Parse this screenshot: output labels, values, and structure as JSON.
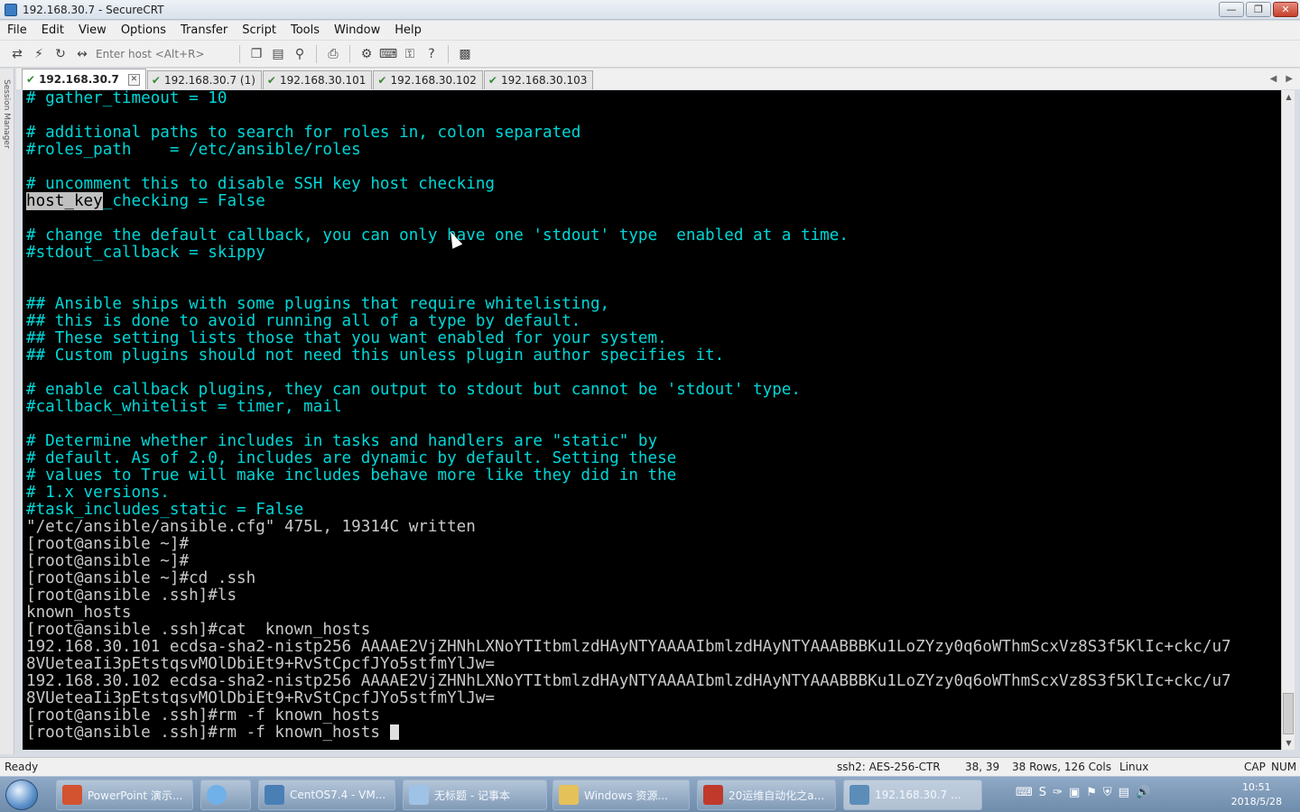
{
  "window": {
    "title": "192.168.30.7 - SecureCRT"
  },
  "menu": [
    "File",
    "Edit",
    "View",
    "Options",
    "Transfer",
    "Script",
    "Tools",
    "Window",
    "Help"
  ],
  "toolbar": {
    "enter_host_placeholder": "Enter host <Alt+R>"
  },
  "session_manager_label": "Session Manager",
  "tabs": [
    {
      "label": "192.168.30.7",
      "active": true
    },
    {
      "label": "192.168.30.7 (1)",
      "active": false
    },
    {
      "label": "192.168.30.101",
      "active": false
    },
    {
      "label": "192.168.30.102",
      "active": false
    },
    {
      "label": "192.168.30.103",
      "active": false
    }
  ],
  "terminal": {
    "lines": [
      {
        "text": "# gather_timeout = 10",
        "style": "comment"
      },
      {
        "text": "",
        "style": "comment"
      },
      {
        "text": "# additional paths to search for roles in, colon separated",
        "style": "comment"
      },
      {
        "text": "#roles_path    = /etc/ansible/roles",
        "style": "comment"
      },
      {
        "text": "",
        "style": "comment"
      },
      {
        "text": "# uncomment this to disable SSH key host checking",
        "style": "comment"
      },
      {
        "text": "host_key_checking = False",
        "style": "comment",
        "highlight_prefix": "host_key"
      },
      {
        "text": "",
        "style": "comment"
      },
      {
        "text": "# change the default callback, you can only have one 'stdout' type  enabled at a time.",
        "style": "comment"
      },
      {
        "text": "#stdout_callback = skippy",
        "style": "comment"
      },
      {
        "text": "",
        "style": "comment"
      },
      {
        "text": "",
        "style": "comment"
      },
      {
        "text": "## Ansible ships with some plugins that require whitelisting,",
        "style": "comment"
      },
      {
        "text": "## this is done to avoid running all of a type by default.",
        "style": "comment"
      },
      {
        "text": "## These setting lists those that you want enabled for your system.",
        "style": "comment"
      },
      {
        "text": "## Custom plugins should not need this unless plugin author specifies it.",
        "style": "comment"
      },
      {
        "text": "",
        "style": "comment"
      },
      {
        "text": "# enable callback plugins, they can output to stdout but cannot be 'stdout' type.",
        "style": "comment"
      },
      {
        "text": "#callback_whitelist = timer, mail",
        "style": "comment"
      },
      {
        "text": "",
        "style": "comment"
      },
      {
        "text": "# Determine whether includes in tasks and handlers are \"static\" by",
        "style": "comment"
      },
      {
        "text": "# default. As of 2.0, includes are dynamic by default. Setting these",
        "style": "comment"
      },
      {
        "text": "# values to True will make includes behave more like they did in the",
        "style": "comment"
      },
      {
        "text": "# 1.x versions.",
        "style": "comment"
      },
      {
        "text": "#task_includes_static = False",
        "style": "comment"
      },
      {
        "text": "\"/etc/ansible/ansible.cfg\" 475L, 19314C written",
        "style": "plain"
      },
      {
        "text": "[root@ansible ~]#",
        "style": "plain"
      },
      {
        "text": "[root@ansible ~]#",
        "style": "plain"
      },
      {
        "text": "[root@ansible ~]#cd .ssh",
        "style": "plain"
      },
      {
        "text": "[root@ansible .ssh]#ls",
        "style": "plain"
      },
      {
        "text": "known_hosts",
        "style": "plain"
      },
      {
        "text": "[root@ansible .ssh]#cat  known_hosts",
        "style": "plain"
      },
      {
        "text": "192.168.30.101 ecdsa-sha2-nistp256 AAAAE2VjZHNhLXNoYTItbmlzdHAyNTYAAAAIbmlzdHAyNTYAAABBBKu1LoZYzy0q6oWThmScxVz8S3f5KlIc+ckc/u7",
        "style": "plain"
      },
      {
        "text": "8VUeteaIi3pEtstqsvMOlDbiEt9+RvStCpcfJYo5stfmYlJw=",
        "style": "plain"
      },
      {
        "text": "192.168.30.102 ecdsa-sha2-nistp256 AAAAE2VjZHNhLXNoYTItbmlzdHAyNTYAAAAIbmlzdHAyNTYAAABBBKu1LoZYzy0q6oWThmScxVz8S3f5KlIc+ckc/u7",
        "style": "plain"
      },
      {
        "text": "8VUeteaIi3pEtstqsvMOlDbiEt9+RvStCpcfJYo5stfmYlJw=",
        "style": "plain"
      },
      {
        "text": "[root@ansible .ssh]#rm -f known_hosts",
        "style": "plain"
      },
      {
        "text": "[root@ansible .ssh]#rm -f known_hosts ",
        "style": "plain",
        "cursor": true
      }
    ]
  },
  "status": {
    "ready": "Ready",
    "cipher": "ssh2: AES-256-CTR",
    "position": "38,  39",
    "size": "38 Rows, 126 Cols",
    "os": "Linux",
    "cap": "CAP",
    "num": "NUM"
  },
  "taskbar": {
    "items": [
      {
        "label": "PowerPoint 演示...",
        "icon_color": "#d35230"
      },
      {
        "label": "",
        "icon_color": "#6fb1e8"
      },
      {
        "label": "CentOS7.4 - VM...",
        "icon_color": "#4a7fb5"
      },
      {
        "label": "无标题 - 记事本",
        "icon_color": "#9fc3e6"
      },
      {
        "label": "Windows 资源...",
        "icon_color": "#e5c15a"
      },
      {
        "label": "20运维自动化之a...",
        "icon_color": "#c0392b"
      },
      {
        "label": "192.168.30.7 ...",
        "icon_color": "#5b8db8"
      }
    ],
    "clock_time": "10:51",
    "clock_date": "2018/5/28"
  }
}
